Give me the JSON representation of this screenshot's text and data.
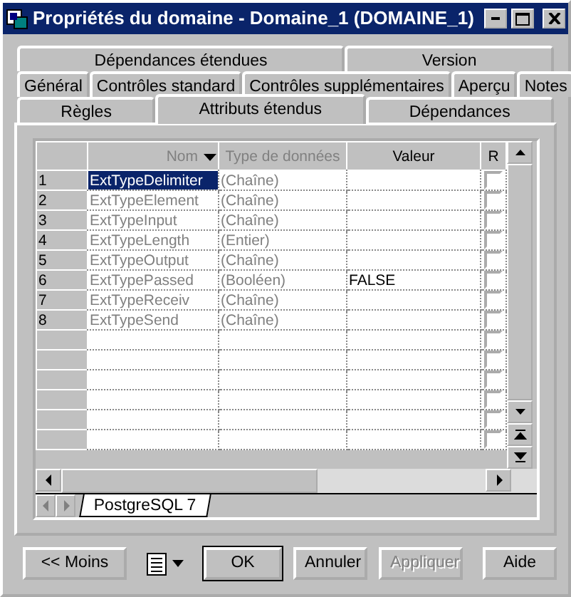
{
  "window": {
    "title": "Propriétés du domaine - Domaine_1 (DOMAINE_1)"
  },
  "tab_rows": [
    [
      {
        "label": "Dépendances étendues",
        "selected": false
      },
      {
        "label": "Version",
        "selected": false
      }
    ],
    [
      {
        "label": "Général",
        "selected": false
      },
      {
        "label": "Contrôles standard",
        "selected": false
      },
      {
        "label": "Contrôles supplémentaires",
        "selected": false
      },
      {
        "label": "Aperçu",
        "selected": false
      },
      {
        "label": "Notes",
        "selected": false
      }
    ],
    [
      {
        "label": "Règles",
        "selected": false
      },
      {
        "label": "Attributs étendus",
        "selected": true
      },
      {
        "label": "Dépendances",
        "selected": false
      }
    ]
  ],
  "grid": {
    "columns": [
      {
        "label": "Nom",
        "sortable": true
      },
      {
        "label": "Type de données"
      },
      {
        "label": "Valeur"
      },
      {
        "label": "R"
      }
    ],
    "rows": [
      {
        "number": "1",
        "name": "ExtTypeDelimiter",
        "type": "(Chaîne)",
        "selected": true,
        "checked": false
      },
      {
        "number": "2",
        "name": "ExtTypeElement",
        "type": "(Chaîne)",
        "selected": false,
        "checked": false
      },
      {
        "number": "3",
        "name": "ExtTypeInput",
        "type": "(Chaîne)",
        "selected": false,
        "checked": false
      },
      {
        "number": "4",
        "name": "ExtTypeLength",
        "type": "(Entier)",
        "selected": false,
        "checked": false
      },
      {
        "number": "5",
        "name": "ExtTypeOutput",
        "type": "(Chaîne)",
        "selected": false,
        "checked": false
      },
      {
        "number": "6",
        "name": "ExtTypePassed",
        "type": "(Booléen)",
        "value": "FALSE",
        "selected": false,
        "checked": false
      },
      {
        "number": "7",
        "name": "ExtTypeReceiv",
        "type": "(Chaîne)",
        "selected": false,
        "checked": false
      },
      {
        "number": "8",
        "name": "ExtTypeSend",
        "type": "(Chaîne)",
        "selected": false,
        "checked": false
      },
      {
        "checked": false
      },
      {
        "checked": false
      },
      {
        "checked": false
      },
      {
        "checked": false
      },
      {
        "checked": false
      },
      {
        "checked": false
      }
    ]
  },
  "sheet_tabs": [
    {
      "label": "PostgreSQL 7",
      "selected": true
    }
  ],
  "buttons": [
    {
      "kind": "text",
      "label": "<< Moins",
      "disabled": false
    },
    {
      "kind": "menu"
    },
    {
      "kind": "text",
      "label": "OK",
      "disabled": false,
      "default": true
    },
    {
      "kind": "text",
      "label": "Annuler",
      "disabled": false
    },
    {
      "kind": "text",
      "label": "Appliquer",
      "disabled": true
    },
    {
      "kind": "text",
      "label": "Aide",
      "disabled": false
    }
  ]
}
